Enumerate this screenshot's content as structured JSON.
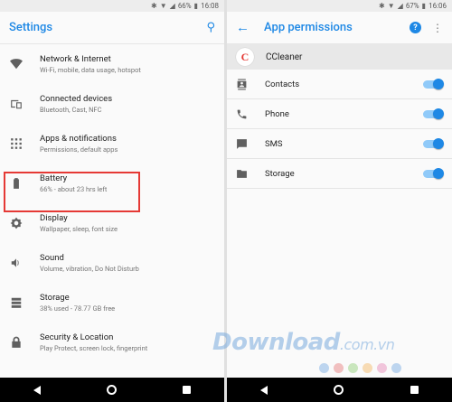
{
  "left": {
    "status": {
      "battery": "66%",
      "time": "16:08"
    },
    "title": "Settings",
    "items": [
      {
        "icon": "wifi-icon",
        "label": "Network & Internet",
        "sub": "Wi-Fi, mobile, data usage, hotspot"
      },
      {
        "icon": "devices-icon",
        "label": "Connected devices",
        "sub": "Bluetooth, Cast, NFC"
      },
      {
        "icon": "apps-grid-icon",
        "label": "Apps & notifications",
        "sub": "Permissions, default apps"
      },
      {
        "icon": "battery-icon",
        "label": "Battery",
        "sub": "66% - about 23 hrs left"
      },
      {
        "icon": "brightness-icon",
        "label": "Display",
        "sub": "Wallpaper, sleep, font size"
      },
      {
        "icon": "volume-icon",
        "label": "Sound",
        "sub": "Volume, vibration, Do Not Disturb"
      },
      {
        "icon": "storage-icon",
        "label": "Storage",
        "sub": "38% used - 78.77 GB free"
      },
      {
        "icon": "lock-icon",
        "label": "Security & Location",
        "sub": "Play Protect, screen lock, fingerprint"
      }
    ]
  },
  "right": {
    "status": {
      "battery": "67%",
      "time": "16:06"
    },
    "title": "App permissions",
    "app": {
      "name": "CCleaner",
      "logo": "C"
    },
    "permissions": [
      {
        "icon": "contacts-icon",
        "label": "Contacts",
        "enabled": true
      },
      {
        "icon": "phone-icon",
        "label": "Phone",
        "enabled": true
      },
      {
        "icon": "sms-icon",
        "label": "SMS",
        "enabled": true
      },
      {
        "icon": "folder-icon",
        "label": "Storage",
        "enabled": true
      }
    ]
  },
  "watermark": {
    "text": "Download",
    "suffix": ".com.vn"
  },
  "colors": {
    "accent": "#1e88e5",
    "highlight": "#e53935",
    "switch_track": "#90caf9"
  }
}
